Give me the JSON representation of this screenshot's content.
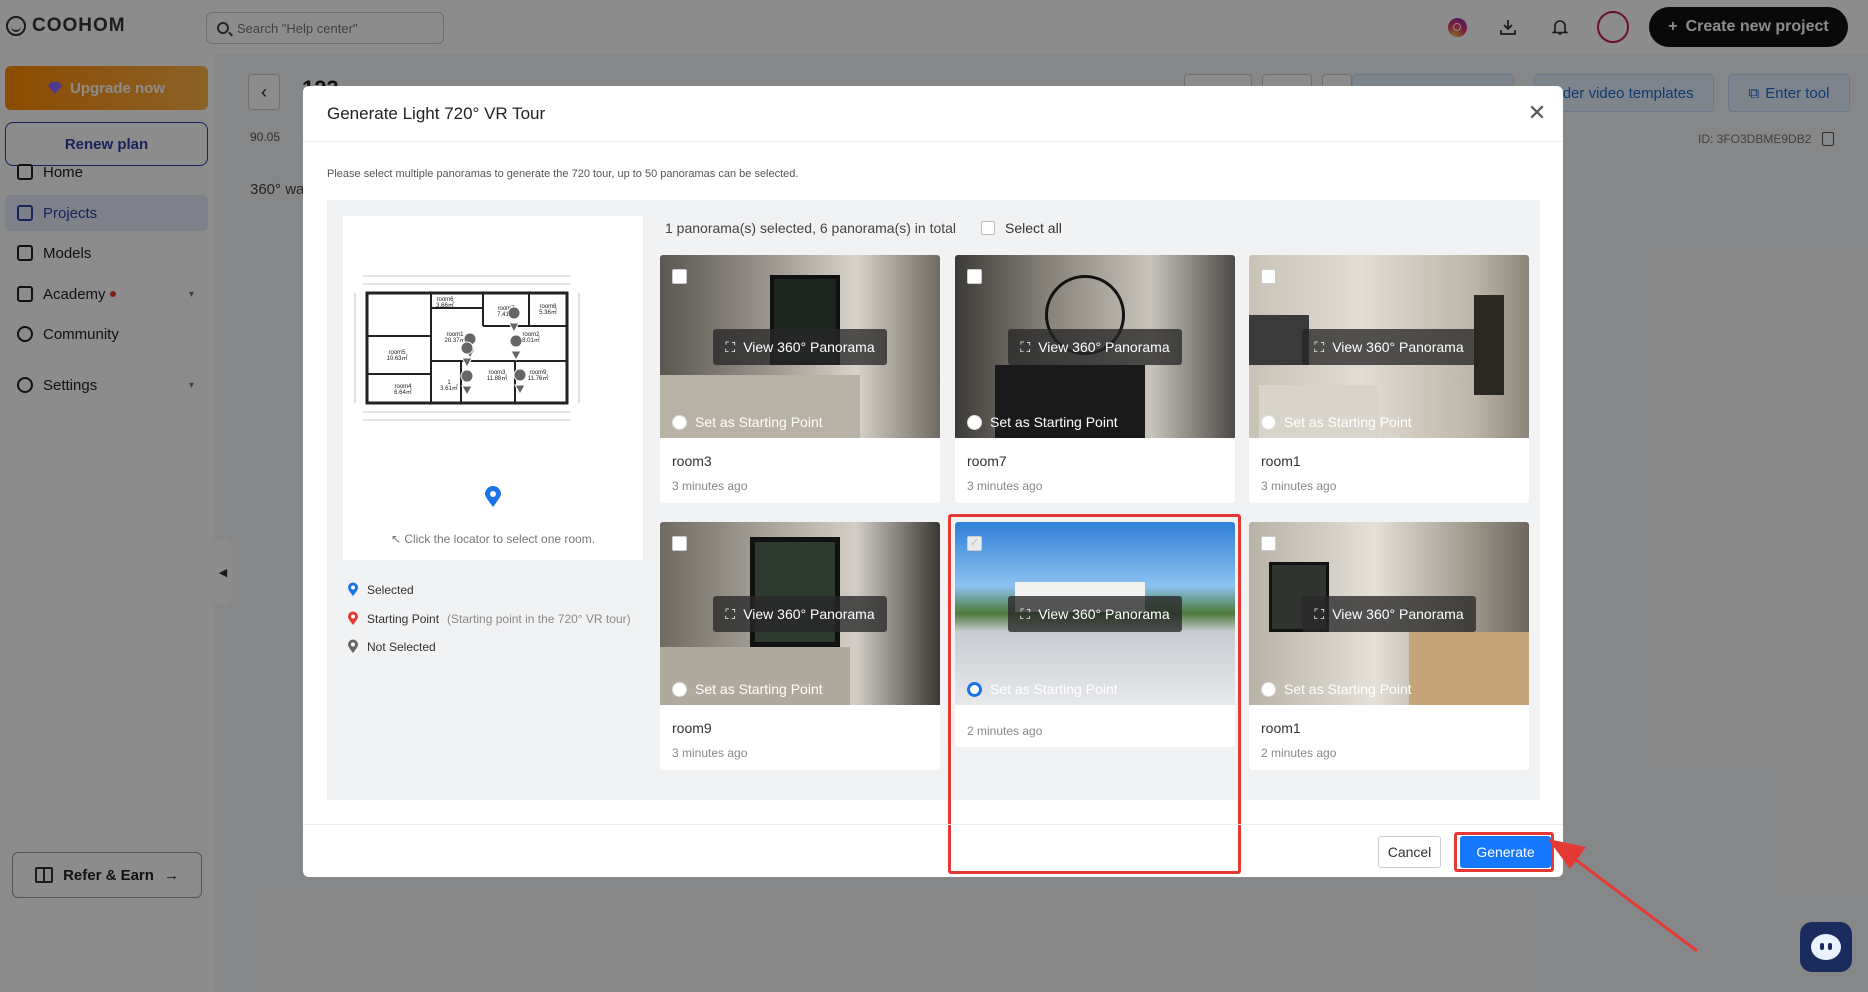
{
  "app": {
    "brand": "COOHOM",
    "search_placeholder": "Search \"Help center\"",
    "create_button": "Create new project"
  },
  "sidebar": {
    "upgrade": "Upgrade now",
    "renew": "Renew plan",
    "items": [
      {
        "label": "Home",
        "icon": "home-icon"
      },
      {
        "label": "Projects",
        "icon": "projects-icon",
        "active": true
      },
      {
        "label": "Models",
        "icon": "models-icon"
      },
      {
        "label": "Academy",
        "icon": "academy-icon",
        "badge": true
      },
      {
        "label": "Community",
        "icon": "community-icon"
      },
      {
        "label": "Settings",
        "icon": "settings-icon"
      }
    ],
    "refer": "Refer & Earn"
  },
  "page": {
    "project_name": "123",
    "area": "90.05",
    "tab": "360° wal",
    "btn_templates": "nder video templates",
    "btn_enter": "Enter tool",
    "id_text": "ID: 3FO3DBME9DB2"
  },
  "modal": {
    "title": "Generate Light 720° VR Tour",
    "instruction": "Please select multiple panoramas to generate the 720 tour, up to 50 panoramas can be selected.",
    "count_text": "1 panorama(s) selected, 6 panorama(s) in total",
    "select_all": "Select all",
    "floorplan_hint": "Click the locator to select one room.",
    "legend": {
      "selected": "Selected",
      "starting": "Starting Point",
      "starting_note": "(Starting point in the 720° VR tour)",
      "not_selected": "Not Selected"
    },
    "view_label": "View 360° Panorama",
    "start_label": "Set as Starting Point",
    "cards": [
      {
        "name": "room3",
        "time": "3 minutes ago",
        "checked": false
      },
      {
        "name": "room7",
        "time": "3 minutes ago",
        "checked": false
      },
      {
        "name": "room1",
        "time": "3 minutes ago",
        "checked": false
      },
      {
        "name": "room9",
        "time": "3 minutes ago",
        "checked": false
      },
      {
        "name": "",
        "time": "2 minutes ago",
        "checked": true
      },
      {
        "name": "room1",
        "time": "2 minutes ago",
        "checked": false
      }
    ],
    "cancel": "Cancel",
    "generate": "Generate"
  },
  "floorplan_rooms": [
    {
      "label": "room6",
      "area": "3.66㎡"
    },
    {
      "label": "room7",
      "area": "7.41㎡"
    },
    {
      "label": "room8",
      "area": "5.36㎡"
    },
    {
      "label": "room5",
      "area": "10.63㎡"
    },
    {
      "label": "room1",
      "area": "20.37㎡"
    },
    {
      "label": "room2",
      "area": "8.01㎡"
    },
    {
      "label": "room3",
      "area": "11.88㎡"
    },
    {
      "label": "room9",
      "area": "11.76㎡"
    },
    {
      "label": "room4",
      "area": "6.64㎡"
    },
    {
      "label": "1",
      "area": "3.61㎡"
    }
  ],
  "colors": {
    "primary": "#1677ff",
    "highlight": "#e53935",
    "brand_dark": "#111111"
  }
}
